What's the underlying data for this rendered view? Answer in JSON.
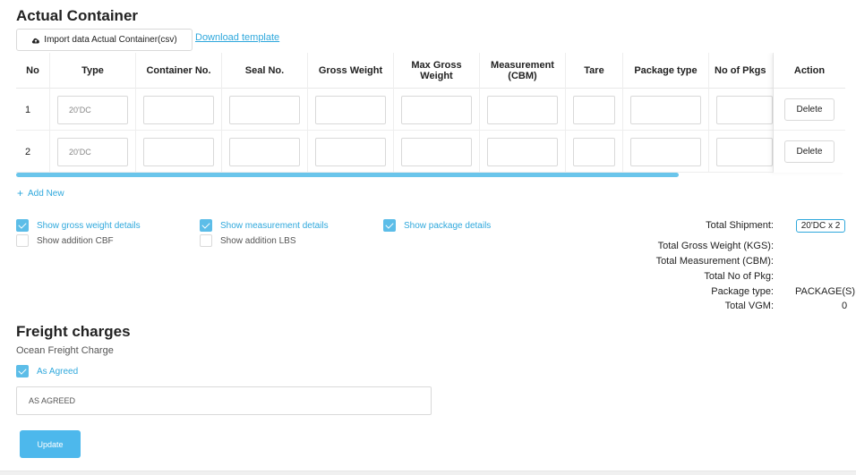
{
  "section_title": "Actual Container",
  "import_button": "Import data Actual Container(csv)",
  "download_link": "Download template",
  "columns": [
    "No",
    "Type",
    "Container No.",
    "Seal No.",
    "Gross Weight",
    "Max Gross Weight",
    "Measurement (CBM)",
    "Tare",
    "Package type",
    "No of Pkgs",
    "Action"
  ],
  "rows": [
    {
      "no": "1",
      "type": "20'DC",
      "delete": "Delete"
    },
    {
      "no": "2",
      "type": "20'DC",
      "delete": "Delete"
    }
  ],
  "add_new": "Add New",
  "checkboxes": {
    "gross_weight": {
      "label": "Show gross weight details",
      "checked": true
    },
    "addition_cbf": {
      "label": "Show addition CBF",
      "checked": false
    },
    "measurement": {
      "label": "Show measurement details",
      "checked": true
    },
    "addition_lbs": {
      "label": "Show addition LBS",
      "checked": false
    },
    "package": {
      "label": "Show package details",
      "checked": true
    }
  },
  "summary": {
    "total_shipment_label": "Total Shipment:",
    "total_shipment_value": "20'DC x 2",
    "gross_weight_label": "Total Gross Weight (KGS):",
    "measurement_label": "Total Measurement (CBM):",
    "no_of_pkg_label": "Total No of Pkg:",
    "package_type_label": "Package type:",
    "package_type_value": "PACKAGE(S)",
    "vgm_label": "Total VGM:",
    "vgm_value": "0"
  },
  "freight": {
    "title": "Freight charges",
    "subtitle": "Ocean Freight Charge",
    "as_agreed_label": "As Agreed",
    "as_agreed_checked": true,
    "input_value": "AS AGREED",
    "update_button": "Update"
  },
  "colors": {
    "accent": "#2fa8dc",
    "button": "#4db8ec",
    "scrollbar": "#6ac5eb"
  }
}
